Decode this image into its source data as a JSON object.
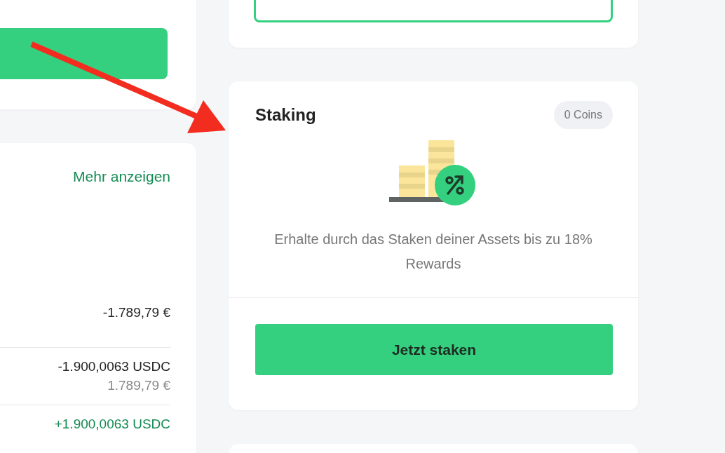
{
  "balance_card": {
    "link": "Mehr anzeigen",
    "total": "-1.789,79 €",
    "transactions": [
      {
        "kind": "outgoing",
        "amount": "-1.900,0063 USDC",
        "fiat": "1.789,79 €"
      },
      {
        "kind": "incoming",
        "amount": "+1.900,0063 USDC"
      }
    ]
  },
  "staking": {
    "title": "Staking",
    "badge": "0 Coins",
    "description": "Erhalte durch das Staken deiner Assets bis zu 18% Rewards",
    "button": "Jetzt staken"
  }
}
